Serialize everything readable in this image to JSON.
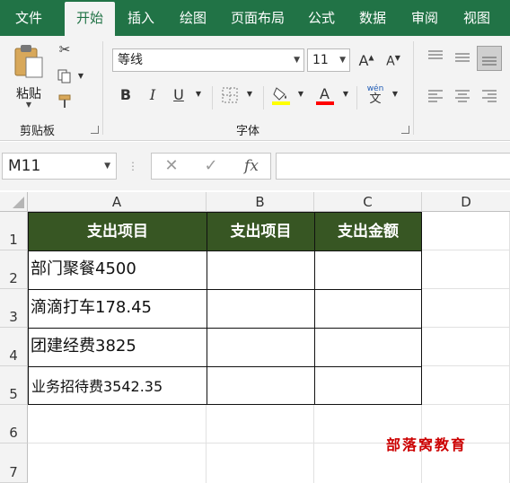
{
  "menu": {
    "items": [
      "文件",
      "开始",
      "插入",
      "绘图",
      "页面布局",
      "公式",
      "数据",
      "审阅",
      "视图"
    ],
    "active": "开始"
  },
  "ribbon": {
    "clipboard": {
      "paste_label": "粘贴",
      "group_label": "剪贴板"
    },
    "font": {
      "font_name": "等线",
      "font_size": "11",
      "bold": "B",
      "italic": "I",
      "underline": "U",
      "group_label": "字体",
      "grow": "A",
      "shrink": "A",
      "phonetic": "wén",
      "fill_color": "#ffff00",
      "font_color": "#ff0000"
    }
  },
  "formula_bar": {
    "name_box": "M11",
    "fx": "fx",
    "value": ""
  },
  "sheet": {
    "columns": [
      "A",
      "B",
      "C",
      "D"
    ],
    "rows": [
      "1",
      "2",
      "3",
      "4",
      "5",
      "6",
      "7"
    ],
    "header_fill": "#375623",
    "table": {
      "headers": [
        "支出项目",
        "支出项目",
        "支出金额"
      ],
      "rows": [
        [
          "部门聚餐4500",
          "",
          ""
        ],
        [
          "滴滴打车178.45",
          "",
          ""
        ],
        [
          "团建经费3825",
          "",
          ""
        ],
        [
          "业务招待费3542.35",
          "",
          ""
        ]
      ]
    },
    "watermark": "部落窝教育"
  }
}
